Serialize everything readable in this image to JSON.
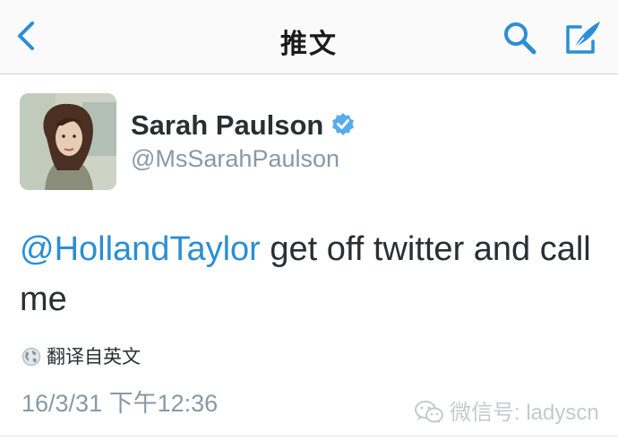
{
  "nav": {
    "title": "推文",
    "back_icon": "chevron-left-icon",
    "search_icon": "search-icon",
    "compose_icon": "compose-quill-icon",
    "accent_color": "#2b8ed6"
  },
  "tweet": {
    "author": {
      "name": "Sarah Paulson",
      "handle": "@MsSarahPaulson",
      "verified_icon": "verified-badge-icon",
      "verified_color": "#55acee"
    },
    "mention": "@HollandTaylor",
    "text_after_mention": " get off twitter and call me",
    "translate_label": "翻译自英文",
    "translate_icon": "globe-icon",
    "timestamp": "16/3/31 下午12:36"
  },
  "watermark": {
    "text": "微信号: ladyscn",
    "icon": "wechat-icon"
  }
}
